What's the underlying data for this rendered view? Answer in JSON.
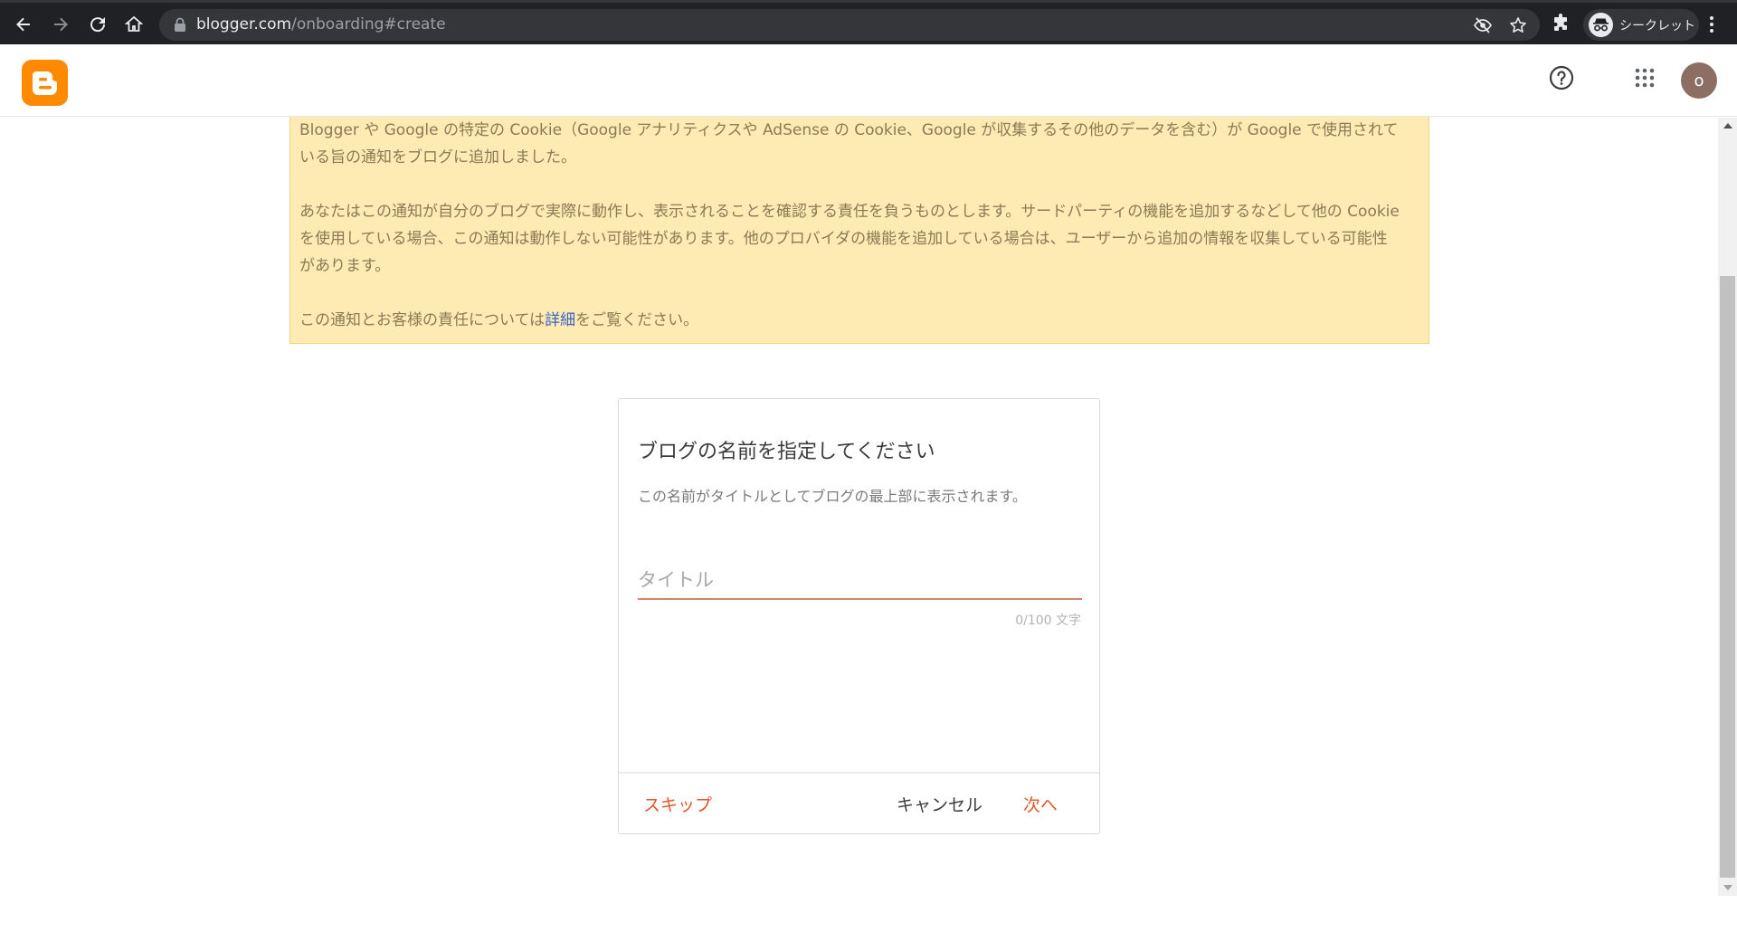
{
  "browser": {
    "url_host": "blogger.com",
    "url_path": "/onboarding#create",
    "incognito_label": "シークレット"
  },
  "header": {
    "avatar_initial": "o"
  },
  "notice": {
    "paragraph1": "Blogger や Google の特定の Cookie（Google アナリティクスや AdSense の Cookie、Google が収集するその他のデータを含む）が Google で使用されている旨の通知をブログに追加しました。",
    "paragraph2": "あなたはこの通知が自分のブログで実際に動作し、表示されることを確認する責任を負うものとします。サードパーティの機能を追加するなどして他の Cookie を使用している場合、この通知は動作しない可能性があります。他のプロバイダの機能を追加している場合は、ユーザーから追加の情報を収集している可能性があります。",
    "paragraph3_before": "この通知とお客様の責任については",
    "paragraph3_link": "詳細",
    "paragraph3_after": "をご覧ください。"
  },
  "dialog": {
    "title": "ブログの名前を指定してください",
    "subtitle": "この名前がタイトルとしてブログの最上部に表示されます。",
    "input_value": "",
    "input_placeholder": "タイトル",
    "counter": "0/100 文字",
    "skip_label": "スキップ",
    "cancel_label": "キャンセル",
    "next_label": "次へ"
  },
  "colors": {
    "brand": "#ff8a00",
    "accent": "#e2572a",
    "notice_bg": "#feeab3",
    "link": "#3b62c4"
  }
}
